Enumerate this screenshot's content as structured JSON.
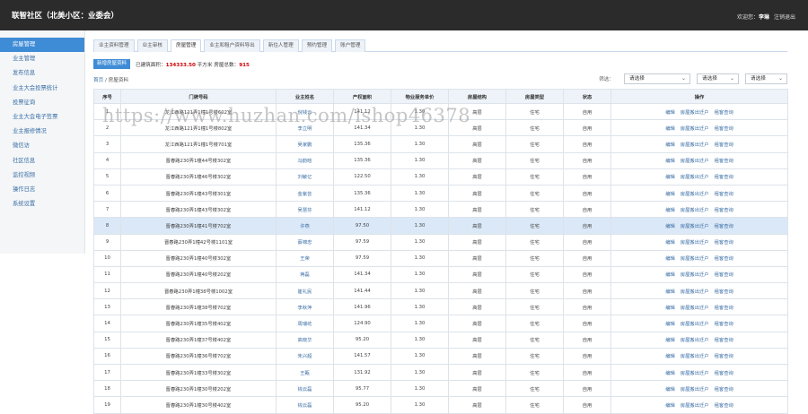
{
  "app": {
    "title": "联智社区（北美小区：业委会）",
    "welcome": "欢迎您：",
    "username": "李琳",
    "logout": "注销退出"
  },
  "sidebar": {
    "items": [
      {
        "label": "房屋管理",
        "active": true
      },
      {
        "label": "业主管理"
      },
      {
        "label": "发布信息"
      },
      {
        "label": "业主大会投票统计"
      },
      {
        "label": "投票征询"
      },
      {
        "label": "业主大会电子签票"
      },
      {
        "label": "业主报修情况"
      },
      {
        "label": "微信访"
      },
      {
        "label": "社区信息"
      },
      {
        "label": "监控视频"
      },
      {
        "label": "操作日志"
      },
      {
        "label": "系统设置"
      }
    ]
  },
  "tabs": [
    {
      "label": "业主资料管理"
    },
    {
      "label": "业主审核"
    },
    {
      "label": "房屋管理",
      "active": true
    },
    {
      "label": "业主和租户资料导出"
    },
    {
      "label": "新住人管理"
    },
    {
      "label": "预约管理"
    },
    {
      "label": "账户管理"
    }
  ],
  "actions": {
    "add_label": "新增房屋资料",
    "area_label": "已建筑面积：",
    "area_value": "134333.50",
    "area_unit": "平方米",
    "count_label": "房屋总数：",
    "count_value": "915"
  },
  "breadcrumb": {
    "home": "首页",
    "sep": " / ",
    "current": "房屋资料"
  },
  "filters": {
    "label": "筛选：",
    "selects": [
      {
        "value": "请选择"
      },
      {
        "value": "请选择"
      },
      {
        "value": "请选择"
      }
    ]
  },
  "table": {
    "headers": [
      "序号",
      "门牌号码",
      "业主姓名",
      "产权面积",
      "物业服务单价",
      "房屋结构",
      "房屋类型",
      "状态",
      "操作"
    ],
    "ops": [
      "编辑",
      "房屋搬出迁户",
      "租客查询"
    ],
    "rows": [
      {
        "no": "1",
        "addr": "龙江西路121弄1幢1号楼602室",
        "name": "倪钱云",
        "area": "141.12",
        "price": "1.30",
        "struct": "高层",
        "type": "住宅",
        "status": "自用"
      },
      {
        "no": "2",
        "addr": "龙江西路121弄1幢1号楼802室",
        "name": "李立明",
        "area": "141.34",
        "price": "1.30",
        "struct": "高层",
        "type": "住宅",
        "status": "自用"
      },
      {
        "no": "3",
        "addr": "龙江西路121弄1幢1号楼701室",
        "name": "吴家鹏",
        "area": "135.36",
        "price": "1.30",
        "struct": "高层",
        "type": "住宅",
        "status": "自用"
      },
      {
        "no": "4",
        "addr": "晋春路230弄1幢44号楼302室",
        "name": "冯韵晗",
        "area": "135.36",
        "price": "1.30",
        "struct": "高层",
        "type": "住宅",
        "status": "自用"
      },
      {
        "no": "5",
        "addr": "晋春路230弄1幢46号楼302室",
        "name": "刘敏亿",
        "area": "122.50",
        "price": "1.30",
        "struct": "高层",
        "type": "住宅",
        "status": "自用"
      },
      {
        "no": "6",
        "addr": "晋春路230弄1幢43号楼301室",
        "name": "金紫芸",
        "area": "135.36",
        "price": "1.30",
        "struct": "高层",
        "type": "住宅",
        "status": "自用"
      },
      {
        "no": "7",
        "addr": "晋春路230弄1幢43号楼302室",
        "name": "吴慧芬",
        "area": "141.12",
        "price": "1.30",
        "struct": "高层",
        "type": "住宅",
        "status": "自用"
      },
      {
        "no": "8",
        "addr": "晋春路230弄1幢41号楼702室",
        "name": "许燕",
        "area": "97.50",
        "price": "1.30",
        "struct": "高层",
        "type": "住宅",
        "status": "自用",
        "hl": true
      },
      {
        "no": "9",
        "addr": "晋春路230弄1幢42号楼1101室",
        "name": "蔡锦忠",
        "area": "97.59",
        "price": "1.30",
        "struct": "高层",
        "type": "住宅",
        "status": "自用"
      },
      {
        "no": "10",
        "addr": "晋春路230弄1幢40号楼302室",
        "name": "王荣",
        "area": "97.59",
        "price": "1.30",
        "struct": "高层",
        "type": "住宅",
        "status": "自用"
      },
      {
        "no": "11",
        "addr": "晋春路230弄1幢40号楼202室",
        "name": "蒋磊",
        "area": "141.34",
        "price": "1.30",
        "struct": "高层",
        "type": "住宅",
        "status": "自用"
      },
      {
        "no": "12",
        "addr": "晋春路230弄1幢38号楼1002室",
        "name": "崔礼民",
        "area": "141.44",
        "price": "1.30",
        "struct": "高层",
        "type": "住宅",
        "status": "自用"
      },
      {
        "no": "13",
        "addr": "晋春路230弄1幢38号楼702室",
        "name": "李秋萍",
        "area": "141.96",
        "price": "1.30",
        "struct": "高层",
        "type": "住宅",
        "status": "自用"
      },
      {
        "no": "14",
        "addr": "晋春路230弄1幢35号楼402室",
        "name": "周瑞屹",
        "area": "124.90",
        "price": "1.30",
        "struct": "高层",
        "type": "住宅",
        "status": "自用"
      },
      {
        "no": "15",
        "addr": "晋春路230弄1幢37号楼402室",
        "name": "高晓华",
        "area": "95.20",
        "price": "1.30",
        "struct": "高层",
        "type": "住宅",
        "status": "自用"
      },
      {
        "no": "16",
        "addr": "晋春路230弄1幢36号楼702室",
        "name": "朱兴超",
        "area": "141.57",
        "price": "1.30",
        "struct": "高层",
        "type": "住宅",
        "status": "自用"
      },
      {
        "no": "17",
        "addr": "晋春路230弄1幢33号楼302室",
        "name": "王甄",
        "area": "131.92",
        "price": "1.30",
        "struct": "高层",
        "type": "住宅",
        "status": "自用"
      },
      {
        "no": "18",
        "addr": "晋春路230弄1幢30号楼202室",
        "name": "钱云磊",
        "area": "95.77",
        "price": "1.30",
        "struct": "高层",
        "type": "住宅",
        "status": "自用"
      },
      {
        "no": "19",
        "addr": "晋春路230弄1幢30号楼402室",
        "name": "钱云磊",
        "area": "95.20",
        "price": "1.30",
        "struct": "高层",
        "type": "住宅",
        "status": "自用"
      }
    ]
  },
  "watermark": "https://www.huzhan.com/ishop46378"
}
